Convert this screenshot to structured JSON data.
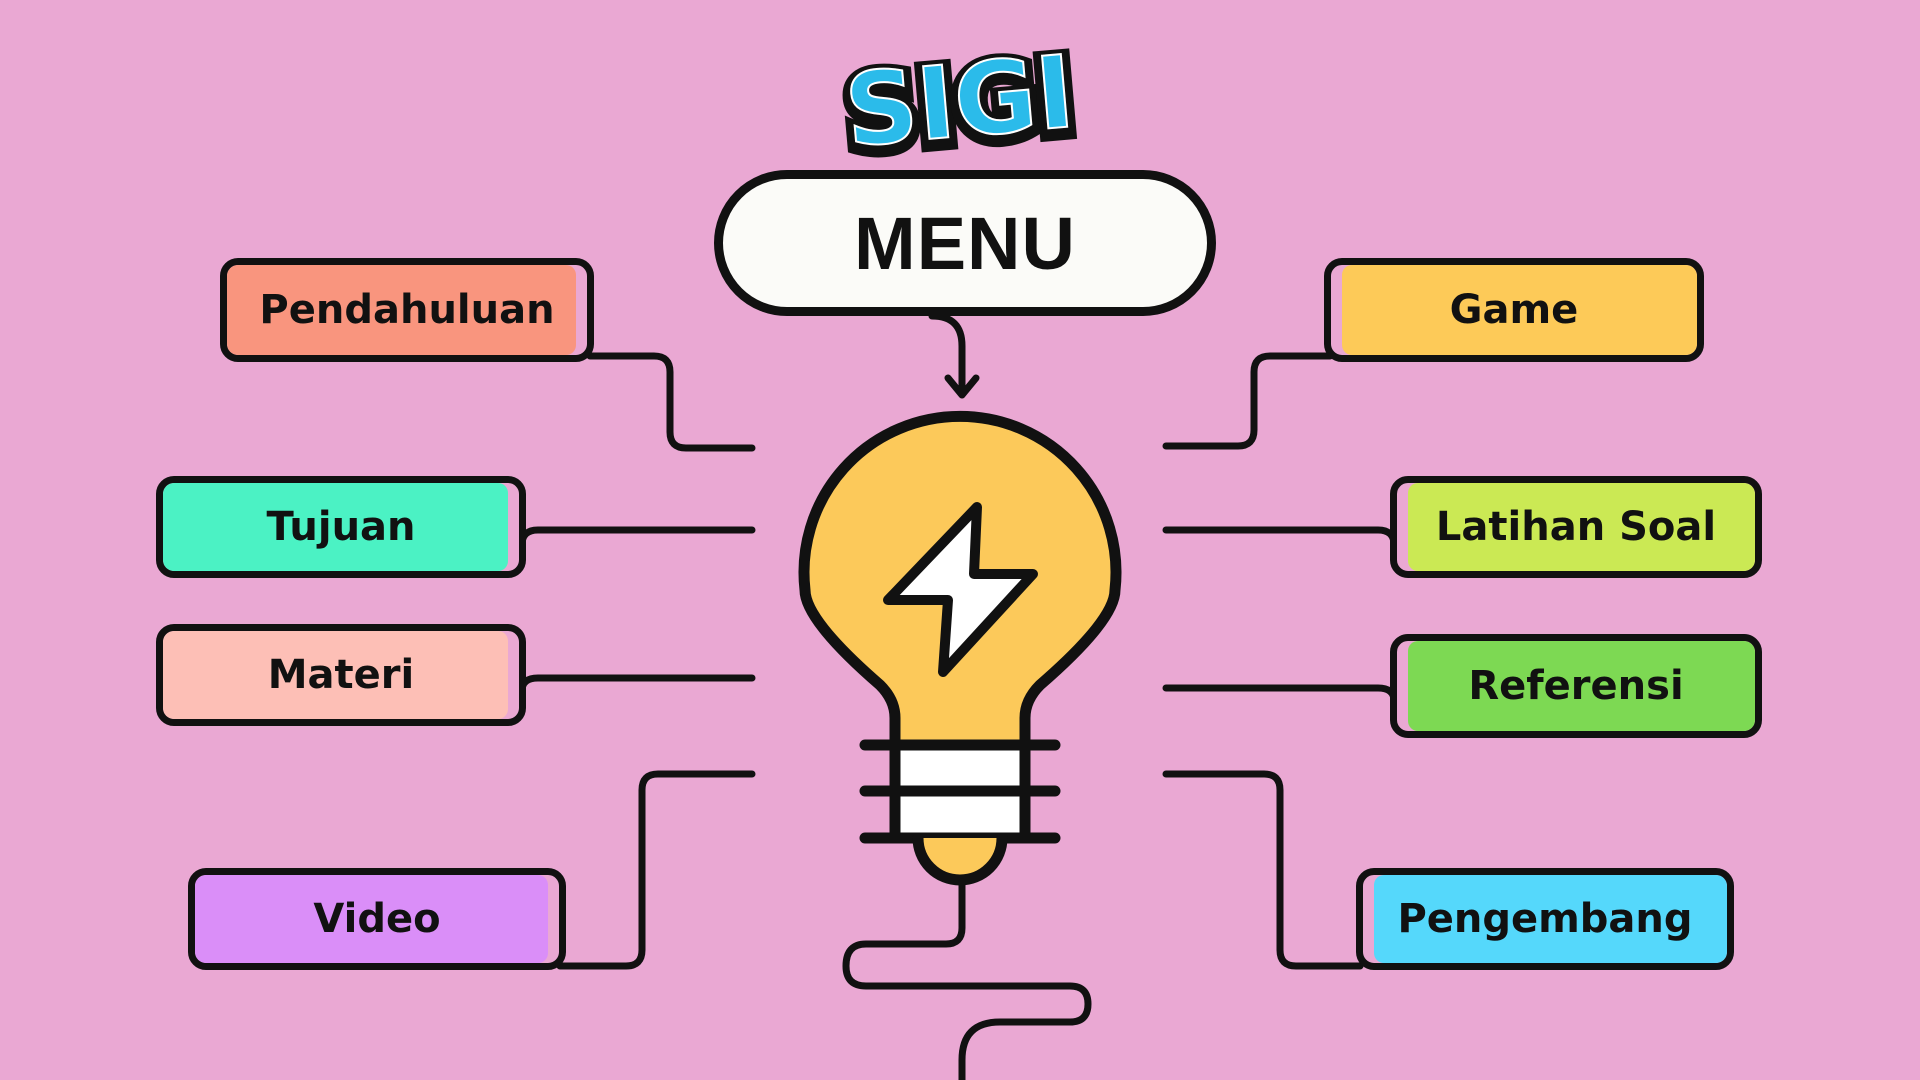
{
  "app": {
    "logo_text": "SIGI",
    "menu_title": "MENU"
  },
  "colors": {
    "background": "#eaa8d3",
    "outline": "#111111",
    "bulb": "#fcc95a",
    "logo_fill": "#2bbbea"
  },
  "menu_left": [
    {
      "label": "Pendahuluan",
      "color": "#f9957e"
    },
    {
      "label": "Tujuan",
      "color": "#4bf2c4"
    },
    {
      "label": "Materi",
      "color": "#fdbfb6"
    },
    {
      "label": "Video",
      "color": "#da8ef8"
    }
  ],
  "menu_right": [
    {
      "label": "Game",
      "color": "#fdca58"
    },
    {
      "label": "Latihan Soal",
      "color": "#cbe954"
    },
    {
      "label": "Referensi",
      "color": "#7dd953"
    },
    {
      "label": "Pengembang",
      "color": "#55d8fb"
    }
  ],
  "icons": {
    "center": "lightbulb-icon",
    "bolt": "lightning-bolt-icon"
  }
}
